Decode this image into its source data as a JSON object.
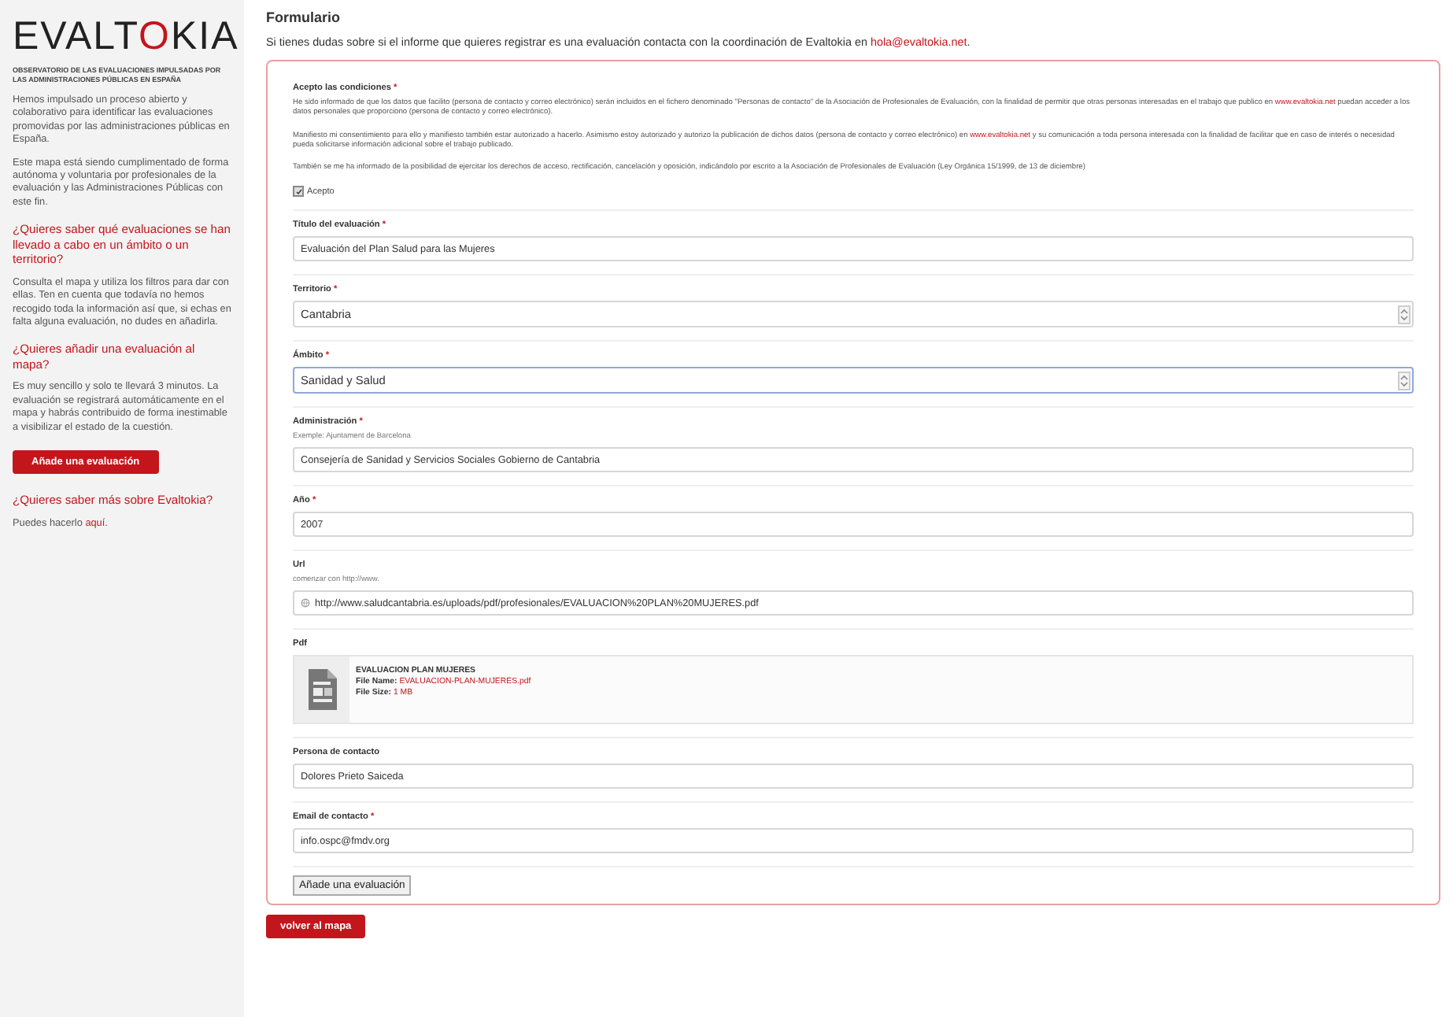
{
  "sidebar": {
    "logo": {
      "before": "EVALT",
      "ring": "O",
      "after": "KIA"
    },
    "subtitle": "OBSERVATORIO DE LAS EVALUACIONES IMPULSADAS POR LAS ADMINISTRACIONES PÚBLICAS EN ESPAÑA",
    "blocks": [
      {
        "kind": "paragraph",
        "text": "Hemos impulsado un proceso abierto y colaborativo para identificar las evaluaciones promovidas por las administraciones públicas en España."
      },
      {
        "kind": "paragraph",
        "text": "Este mapa está siendo cumplimentado de forma autónoma y voluntaria por profesionales de la evaluación y las Administraciones Públicas con este fin."
      },
      {
        "kind": "heading",
        "text": "¿Quieres saber qué evaluaciones se han llevado a cabo en un ámbito o un territorio?"
      },
      {
        "kind": "paragraph",
        "text": "Consulta el mapa y utiliza los filtros para dar con ellas. Ten en cuenta que todavía no hemos recogido toda la información así que, si echas en falta alguna evaluación, no dudes en añadirla."
      },
      {
        "kind": "heading",
        "text": "¿Quieres añadir una evaluación al mapa?"
      },
      {
        "kind": "paragraph",
        "text": "Es muy sencillo y solo te llevará 3 minutos. La evaluación se registrará automáticamente en el mapa y habrás contribuido de forma inestimable a visibilizar el estado de la cuestión."
      },
      {
        "kind": "button",
        "text": "Añade una evaluación"
      },
      {
        "kind": "heading",
        "text": "¿Quieres saber más sobre Evaltokia?"
      },
      {
        "kind": "paragraph",
        "text": "Puedes hacerlo ",
        "link": "aquí."
      }
    ]
  },
  "title": "Formulario",
  "intro": {
    "text": "Si tienes dudas sobre si el informe que quieres registrar es una evaluación contacta con la coordinación de Evaltokia en ",
    "link": "hola@evaltokia.net",
    "after": "."
  },
  "conditions": {
    "label": "Acepto las condiciones",
    "required_mark": "*",
    "paragraphs": [
      [
        {
          "text": "He sido informado de que los datos que facilito (persona de contacto y correo electrónico) serán incluidos en el fichero denominado \"Personas de contacto\" de la Asociación de Profesionales de Evaluación, con la finalidad de permitir que otras personas interesadas en el trabajo que publico en "
        },
        {
          "link": "www.evaltokia.net"
        },
        {
          "text": " puedan acceder a los datos personales que proporciono (persona de contacto y correo electrónico)."
        }
      ],
      [
        {
          "text": "Manifiesto mi consentimiento para ello y manifiesto también estar autorizado a hacerlo. Asimismo estoy autorizado y autorizo la publicación de dichos datos (persona de contacto y correo electrónico) en "
        },
        {
          "link": "www.evaltokia.net"
        },
        {
          "text": " y su comunicación a toda persona interesada con la finalidad de facilitar que en caso de interés o necesidad pueda solicitarse información adicional sobre el trabajo publicado."
        }
      ],
      [
        {
          "text": "También se me ha informado de la posibilidad de ejercitar los derechos de acceso, rectificación, cancelación y oposición, indicándolo por escrito a la Asociación de Profesionales de Evaluación (Ley Orgánica 15/1999, de 13 de diciembre)"
        }
      ]
    ],
    "checkbox": {
      "label": "Acepto",
      "checked": true
    }
  },
  "fields": [
    {
      "kind": "text",
      "label": "Título del evaluación",
      "required_mark": "*",
      "value": "Evaluación del Plan Salud para las Mujeres",
      "focused": false
    },
    {
      "kind": "select",
      "label": "Territorio",
      "required_mark": "*",
      "value": "Cantabria",
      "focused": false
    },
    {
      "kind": "select",
      "label": "Ámbito",
      "required_mark": "*",
      "value": "Sanidad y Salud",
      "focused": true
    },
    {
      "kind": "text",
      "label": "Administración",
      "required_mark": "*",
      "hint": "Exemple: Ajuntament de Barcelona",
      "value": "Consejería de Sanidad y Servicios Sociales Gobierno de Cantabria",
      "focused": false
    },
    {
      "kind": "text",
      "label": "Año",
      "required_mark": "*",
      "value": "2007",
      "focused": false
    },
    {
      "kind": "url",
      "label": "Url",
      "hint": "comenzar con http://www.",
      "value": "http://www.saludcantabria.es/uploads/pdf/profesionales/EVALUACION%20PLAN%20MUJERES.pdf",
      "focused": false
    },
    {
      "kind": "file",
      "label": "Pdf",
      "file": {
        "title": "EVALUACION PLAN MUJERES",
        "name_label": "File Name:",
        "name": "EVALUACION-PLAN-MUJERES.pdf",
        "size_label": "File Size:",
        "size": "1 MB"
      }
    },
    {
      "kind": "text",
      "label": "Persona de contacto",
      "value": "Dolores Prieto Saiceda",
      "focused": false
    },
    {
      "kind": "text",
      "label": "Email de contacto",
      "required_mark": "*",
      "value": "info.ospc@fmdv.org",
      "focused": false
    }
  ],
  "submit": "Añade una evaluación",
  "back": "volver al mapa"
}
